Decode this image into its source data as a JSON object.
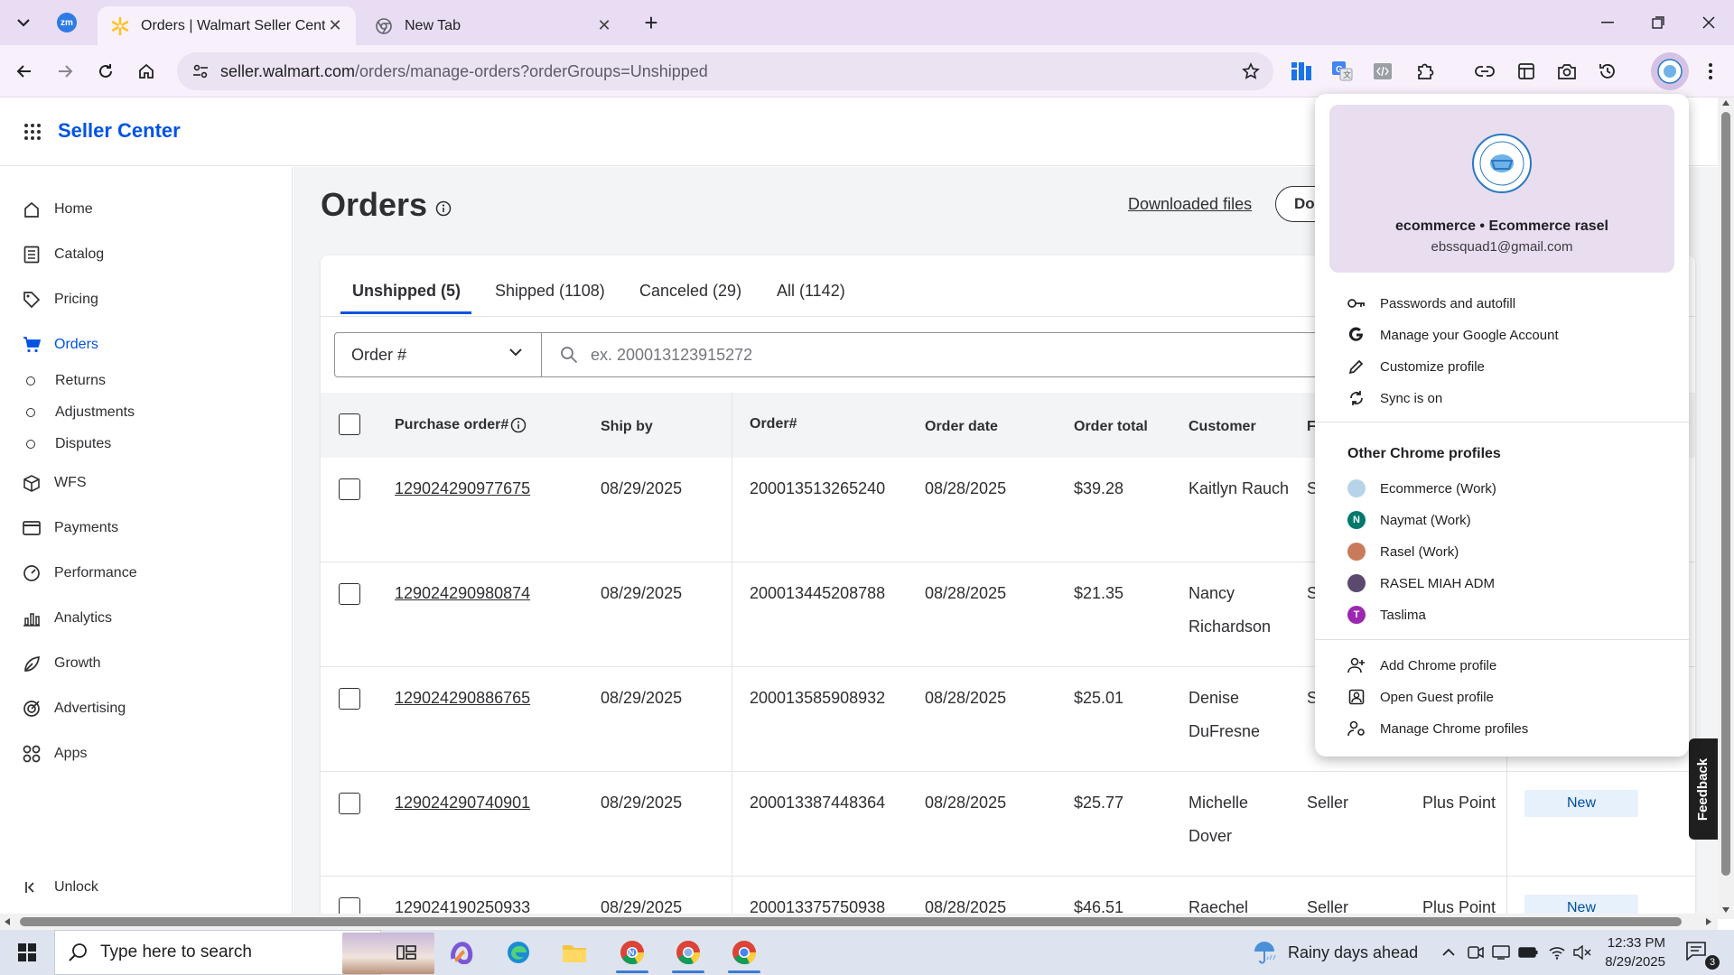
{
  "browser": {
    "tabs": [
      {
        "title": "Orders | Walmart Seller Center",
        "close": "✕"
      },
      {
        "title": "New Tab",
        "close": "✕"
      }
    ],
    "new_tab": "+",
    "url_host": "seller.walmart.com",
    "url_path": "/orders/manage-orders?orderGroups=Unshipped",
    "zoom_ext_label": "zm"
  },
  "seller_center": {
    "brand": "Seller Center",
    "nav": [
      {
        "label": "Home",
        "icon": "home-icon"
      },
      {
        "label": "Catalog",
        "icon": "catalog-icon"
      },
      {
        "label": "Pricing",
        "icon": "tag-icon"
      },
      {
        "label": "Orders",
        "icon": "cart-icon"
      },
      {
        "label": "WFS",
        "icon": "box-icon"
      },
      {
        "label": "Payments",
        "icon": "card-icon"
      },
      {
        "label": "Performance",
        "icon": "gauge-icon"
      },
      {
        "label": "Analytics",
        "icon": "chart-icon"
      },
      {
        "label": "Growth",
        "icon": "sprout-icon"
      },
      {
        "label": "Advertising",
        "icon": "target-icon"
      },
      {
        "label": "Apps",
        "icon": "apps-icon"
      }
    ],
    "orders_subnav": [
      "Returns",
      "Adjustments",
      "Disputes"
    ],
    "unlock": "Unlock"
  },
  "orders": {
    "title": "Orders",
    "downloaded_files": "Downloaded files",
    "download_button": "Do",
    "tabs": [
      "Unshipped (5)",
      "Shipped (1108)",
      "Canceled (29)",
      "All (1142)"
    ],
    "filter_select": "Order #",
    "search_placeholder": "ex. 200013123915272",
    "columns": {
      "purchase_order": "Purchase order#",
      "ship_by": "Ship by",
      "order_num": "Order#",
      "order_date": "Order date",
      "order_total": "Order total",
      "customer": "Customer",
      "fulfillment_partial": "F"
    },
    "rows": [
      {
        "po": "129024290977675",
        "ship_by": "08/29/2025",
        "order": "200013513265240",
        "date": "08/28/2025",
        "total": "$39.28",
        "customer": "Kaitlyn Rauch",
        "col7": "S",
        "col8": "",
        "status": ""
      },
      {
        "po": "129024290980874",
        "ship_by": "08/29/2025",
        "order": "200013445208788",
        "date": "08/28/2025",
        "total": "$21.35",
        "customer": "Nancy Richardson",
        "col7": "S",
        "col8": "",
        "status": ""
      },
      {
        "po": "129024290886765",
        "ship_by": "08/29/2025",
        "order": "200013585908932",
        "date": "08/28/2025",
        "total": "$25.01",
        "customer": "Denise DuFresne",
        "col7": "S",
        "col8": "",
        "status": ""
      },
      {
        "po": "129024290740901",
        "ship_by": "08/29/2025",
        "order": "200013387448364",
        "date": "08/28/2025",
        "total": "$25.77",
        "customer": "Michelle Dover",
        "col7": "Seller",
        "col8": "Plus Point",
        "status": "New"
      },
      {
        "po": "129024190250933",
        "ship_by": "08/29/2025",
        "order": "200013375750938",
        "date": "08/28/2025",
        "total": "$46.51",
        "customer": "Raechel",
        "col7": "Seller",
        "col8": "Plus Point",
        "status": "New"
      }
    ],
    "feedback": "Feedback"
  },
  "profile_menu": {
    "name": "ecommerce • Ecommerce rasel",
    "email": "ebssquad1@gmail.com",
    "items": [
      {
        "label": "Passwords and autofill",
        "icon": "key-icon"
      },
      {
        "label": "Manage your Google Account",
        "icon": "google-icon"
      },
      {
        "label": "Customize profile",
        "icon": "pencil-icon"
      },
      {
        "label": "Sync is on",
        "icon": "sync-icon"
      }
    ],
    "other_profiles_title": "Other Chrome profiles",
    "profiles": [
      {
        "label": "Ecommerce (Work)",
        "initial": "",
        "color": "#b7d3e8"
      },
      {
        "label": "Naymat (Work)",
        "initial": "N",
        "color": "#00796b"
      },
      {
        "label": "Rasel (Work)",
        "initial": "",
        "color": "#c97a5a"
      },
      {
        "label": "RASEL MIAH ADM",
        "initial": "",
        "color": "#5b4a6e"
      },
      {
        "label": "Taslima",
        "initial": "T",
        "color": "#9c27b0"
      }
    ],
    "actions": [
      {
        "label": "Add Chrome profile",
        "icon": "add-person-icon"
      },
      {
        "label": "Open Guest profile",
        "icon": "guest-icon"
      },
      {
        "label": "Manage Chrome profiles",
        "icon": "manage-profiles-icon"
      }
    ]
  },
  "taskbar": {
    "search_placeholder": "Type here to search",
    "weather": "Rainy days ahead",
    "time": "12:33 PM",
    "date": "8/29/2025",
    "notifications": "3"
  },
  "colors": {
    "walmart_blue": "#0053e2",
    "chrome_tabstrip": "#e9ddf3",
    "badge_bg": "#e6f1fc"
  }
}
